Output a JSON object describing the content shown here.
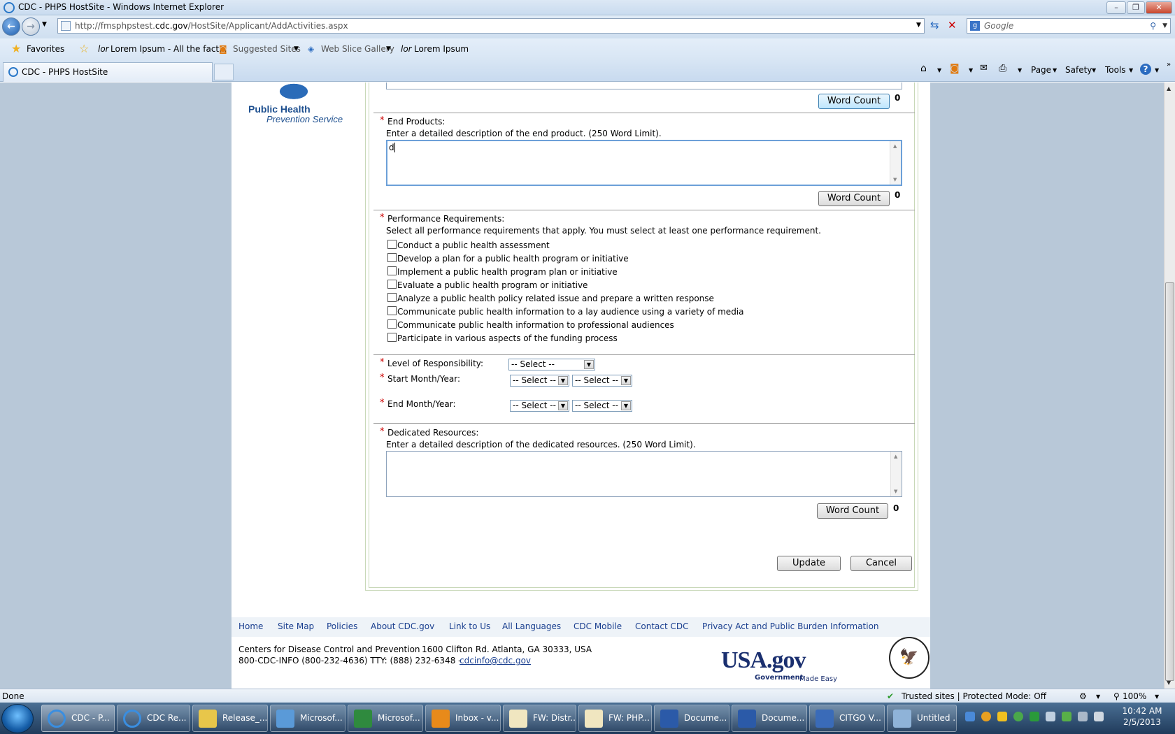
{
  "window": {
    "title": "CDC - PHPS HostSite - Windows Internet Explorer"
  },
  "address_bar": {
    "url_prefix": "http://fmsphpstest.",
    "url_host": "cdc.gov",
    "url_path": "/HostSite/Applicant/AddActivities.aspx",
    "search_placeholder": "Google"
  },
  "favorites_bar": {
    "favorites_label": "Favorites",
    "items": [
      "Lorem Ipsum - All the fact...",
      "Suggested Sites",
      "Web Slice Gallery",
      "Lorem Ipsum"
    ]
  },
  "tabs": {
    "active_tab": "CDC - PHPS HostSite"
  },
  "command_bar": {
    "page": "Page",
    "safety": "Safety",
    "tools": "Tools"
  },
  "logo": {
    "line1": "Public Health",
    "line2": "Prevention Service"
  },
  "form": {
    "word_count_label": "Word Count",
    "top_word_count": "0",
    "end_products": {
      "label": "End Products:",
      "instructions": "Enter a detailed description of the end product. (250 Word Limit).",
      "value": "d",
      "word_count": "0"
    },
    "performance": {
      "label": "Performance Requirements:",
      "instructions": "Select all performance requirements that apply. You must select at least one performance requirement.",
      "options": [
        "Conduct a public health assessment",
        "Develop a plan for a public health program or initiative",
        "Implement a public health program plan or initiative",
        "Evaluate a public health program or initiative",
        "Analyze a public health policy related issue and prepare a written response",
        "Communicate public health information to a lay audience using a variety of media",
        "Communicate public health information to professional audiences",
        "Participate in various aspects of the funding process"
      ]
    },
    "level_label": "Level of Responsibility:",
    "level_value": "-- Select --",
    "start_label": "Start Month/Year:",
    "end_label": "End Month/Year:",
    "select_value": "-- Select --",
    "dedicated": {
      "label": "Dedicated Resources:",
      "instructions": "Enter a detailed description of the dedicated resources. (250 Word Limit).",
      "value": "",
      "word_count": "0"
    },
    "update_label": "Update",
    "cancel_label": "Cancel"
  },
  "footer": {
    "links": [
      "Home",
      "Site Map",
      "Policies",
      "About CDC.gov",
      "Link to Us",
      "All Languages",
      "CDC Mobile",
      "Contact CDC",
      "Privacy Act and Public Burden Information"
    ],
    "org": "Centers for Disease Control and Prevention",
    "street": "1600 Clifton Rd. Atlanta, GA 30333, USA",
    "phone": "800-CDC-INFO (800-232-4636) TTY: (888) 232-6348 -",
    "email": "cdcinfo@cdc.gov",
    "usa_gov": "USA.gov",
    "usa_tag1": "Government",
    "usa_tag2": "Made Easy"
  },
  "status_bar": {
    "status": "Done",
    "zone": "Trusted sites | Protected Mode: Off",
    "zoom": "100%"
  },
  "taskbar": {
    "items": [
      "CDC - P...",
      "CDC Re...",
      "Release_...",
      "Microsof...",
      "Microsof...",
      "Inbox - v...",
      "FW: Distr...",
      "FW: PHP...",
      "Docume...",
      "Docume...",
      "CITGO V...",
      "Untitled ..."
    ],
    "time": "10:42 AM",
    "date": "2/5/2013"
  },
  "colors": {
    "accent": "#1a3f8f",
    "required": "#cc0000",
    "page_bg": "#b8c8d8"
  }
}
